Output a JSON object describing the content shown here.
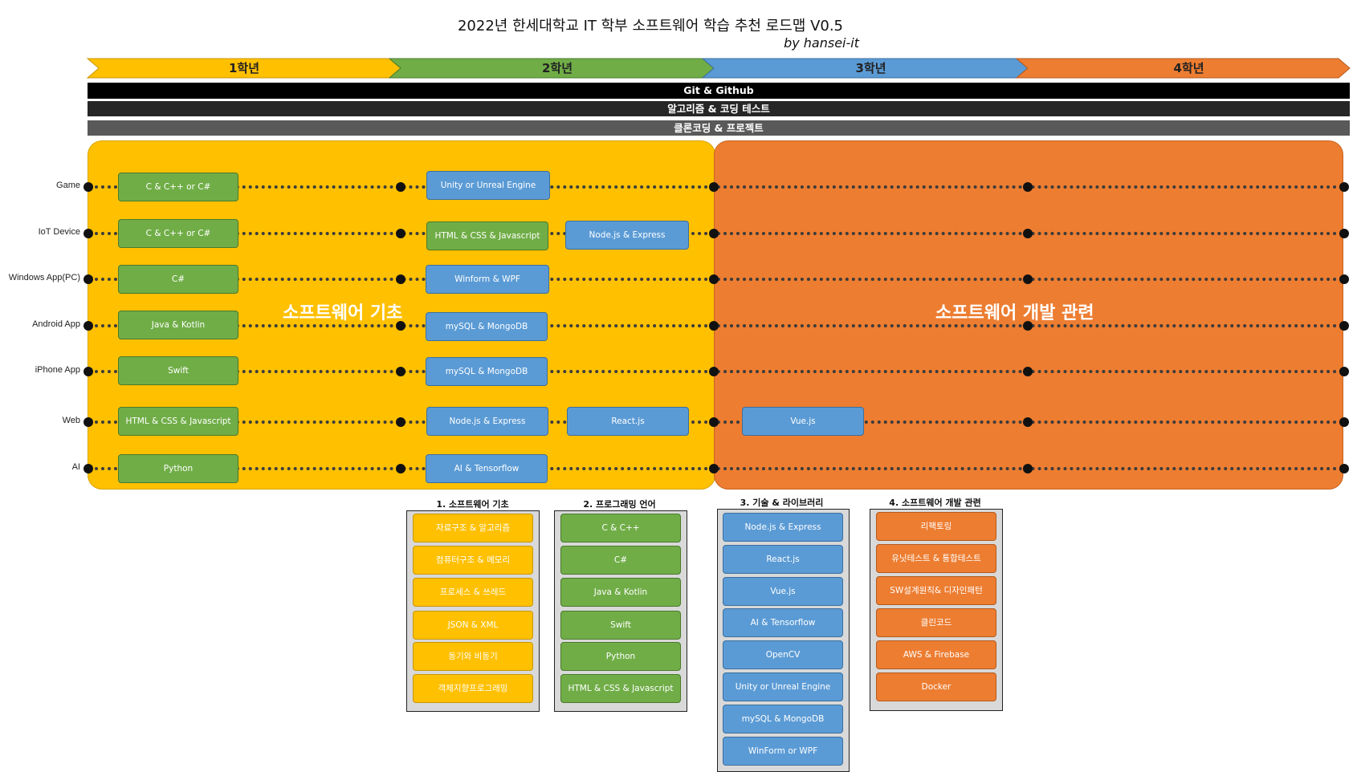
{
  "header": {
    "title": "2022년 한세대학교 IT 학부 소프트웨어 학습 추천 로드맵 V0.5",
    "subtitle": "by hansei-it"
  },
  "years": [
    "1학년",
    "2학년",
    "3학년",
    "4학년"
  ],
  "bars": [
    "Git & Github",
    "알고리즘 & 코딩 테스트",
    "클론코딩 & 프로젝트"
  ],
  "panels": {
    "left_label": "소프트웨어 기초",
    "right_label": "소프트웨어 개발 관련"
  },
  "tracks": [
    {
      "label": "Game",
      "nodes": [
        "C & C++ or C#",
        "Unity or Unreal Engine"
      ]
    },
    {
      "label": "IoT Device",
      "nodes": [
        "C & C++ or C#",
        "HTML & CSS & Javascript",
        "Node.js & Express"
      ]
    },
    {
      "label": "Windows App(PC)",
      "nodes": [
        "C#",
        "Winform & WPF"
      ]
    },
    {
      "label": "Android App",
      "nodes": [
        "Java & Kotlin",
        "mySQL & MongoDB"
      ]
    },
    {
      "label": "iPhone App",
      "nodes": [
        "Swift",
        "mySQL & MongoDB"
      ]
    },
    {
      "label": "Web",
      "nodes": [
        "HTML & CSS & Javascript",
        "Node.js & Express",
        "React.js",
        "Vue.js"
      ]
    },
    {
      "label": "AI",
      "nodes": [
        "Python",
        "AI & Tensorflow"
      ]
    }
  ],
  "categories": [
    {
      "title": "1. 소프트웨어 기초",
      "items": [
        "자료구조 & 알고리즘",
        "컴퓨터구조 & 메모리",
        "프로세스 & 쓰레드",
        "JSON & XML",
        "동기와 비동기",
        "객체지향프로그래밍"
      ]
    },
    {
      "title": "2. 프로그래밍 언어",
      "items": [
        "C & C++",
        "C#",
        "Java & Kotlin",
        "Swift",
        "Python",
        "HTML & CSS & Javascript"
      ]
    },
    {
      "title": "3. 기술 & 라이브러리",
      "items": [
        "Node.js & Express",
        "React.js",
        "Vue.js",
        "AI & Tensorflow",
        "OpenCV",
        "Unity or Unreal Engine",
        "mySQL & MongoDB",
        "WinForm or WPF"
      ]
    },
    {
      "title": "4. 소프트웨어 개발 관련",
      "items": [
        "리팩토링",
        "유닛테스트 & 통합테스트",
        "SW설계원칙& 디자인패턴",
        "클린코드",
        "AWS & Firebase",
        "Docker"
      ]
    }
  ],
  "colors": {
    "year1": "#FFC000",
    "year2": "#70AD47",
    "year3": "#5B9BD5",
    "year4": "#ED7D31",
    "bar1": "#000000",
    "bar2": "#262626",
    "bar3": "#595959"
  }
}
